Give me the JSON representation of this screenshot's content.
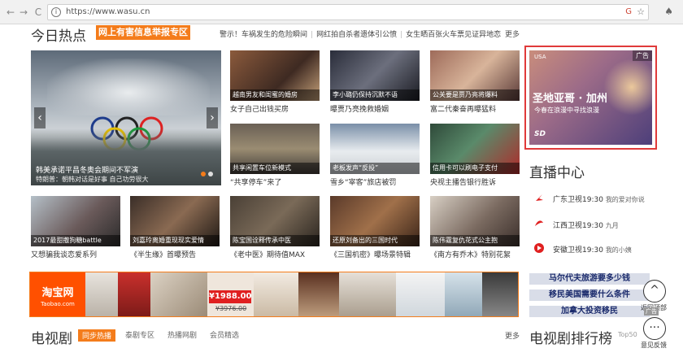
{
  "browser": {
    "url": "https://www.wasu.cn",
    "back": "←",
    "forward": "→",
    "reload": "C",
    "info": "i",
    "ext": "G",
    "star": "☆",
    "menu": "♠"
  },
  "hot": {
    "title": "今日热点",
    "report_badge": "网上有害信息举报专区",
    "ticker": [
      "警示！车祸发生的危险瞬间",
      "网红拍自杀者遗体引公愤",
      "女生晒百张火车票见证异地恋"
    ],
    "more": "更多"
  },
  "slide": {
    "caption": "韩美承诺平昌冬奥会期间不军演",
    "subcaption": "特朗普：朝韩对话是好事 自己功劳很大",
    "prev": "‹",
    "next": "›"
  },
  "thumbs": [
    {
      "overlay": "越南男友和闺蜜的婚房",
      "caption": "女子自己出钱买房"
    },
    {
      "overlay": "李小璐仍保持沉默不语",
      "caption": "曝贾乃亮挽救婚姻"
    },
    {
      "overlay": "公关要是贾乃亮将爆料",
      "caption": "富二代秦奋再曝猛料"
    },
    {
      "overlay": "共享闲置车位新模式",
      "caption": "“共享停车”来了"
    },
    {
      "overlay": "老板发声“反投”",
      "caption": "雪乡“宰客”旅店被罚"
    },
    {
      "overlay": "信用卡可以刷电子支付",
      "caption": "央视主播告银行胜诉"
    },
    {
      "overlay": "2017最甜撒狗糖battle",
      "caption": "又想骗我谈恋爱系列"
    },
    {
      "overlay": "刘嘉玲离婚重现现实爱情",
      "caption": "《半生缘》首曝预告"
    },
    {
      "overlay": "陈宝国诠释传承中医",
      "caption": "《老中医》期待值MAX"
    },
    {
      "overlay": "还原刘备出的三国时代",
      "caption": "《三国机密》曝场景特辑"
    },
    {
      "overlay": "陈伟霆复仇花式公主抱",
      "caption": "《南方有乔木》特别花絮"
    }
  ],
  "ad": {
    "usa": "USA",
    "tag": "广告",
    "title": "圣地亚哥 · 加州",
    "subtitle": "今春在浪漫中寻找浪漫",
    "logo": "SD"
  },
  "live": {
    "title": "直播中心",
    "rows": [
      {
        "channel": "广东卫视19:30",
        "program": "我的爱对你说"
      },
      {
        "channel": "江西卫视19:30",
        "program": "九月"
      },
      {
        "channel": "安徽卫视19:30",
        "program": "我的小姨"
      }
    ]
  },
  "banner": {
    "brand": "淘宝网",
    "brand_sub": "Taobao.com",
    "price": "¥1988.00",
    "old_price": "¥3976.00"
  },
  "links": [
    "马尔代夫旅游要多少钱",
    "移民美国需要什么条件",
    "加拿大投资移民"
  ],
  "float": {
    "top_label": "返回顶部",
    "feedback_label": "意见反馈",
    "ad_label": "广告",
    "top_icon": "^",
    "more_icon": "···"
  },
  "tv": {
    "title": "电视剧",
    "tabs": [
      "同步热播",
      "泰剧专区",
      "热播网剧",
      "会员精选"
    ],
    "more": "更多"
  },
  "ranking": {
    "title": "电视剧排行榜",
    "tag": "Top50"
  },
  "colors": {
    "accent": "#f47c1b",
    "ad_border": "#e03a3a",
    "taobao": "#ff5000",
    "link_bg": "#d9dde8"
  }
}
